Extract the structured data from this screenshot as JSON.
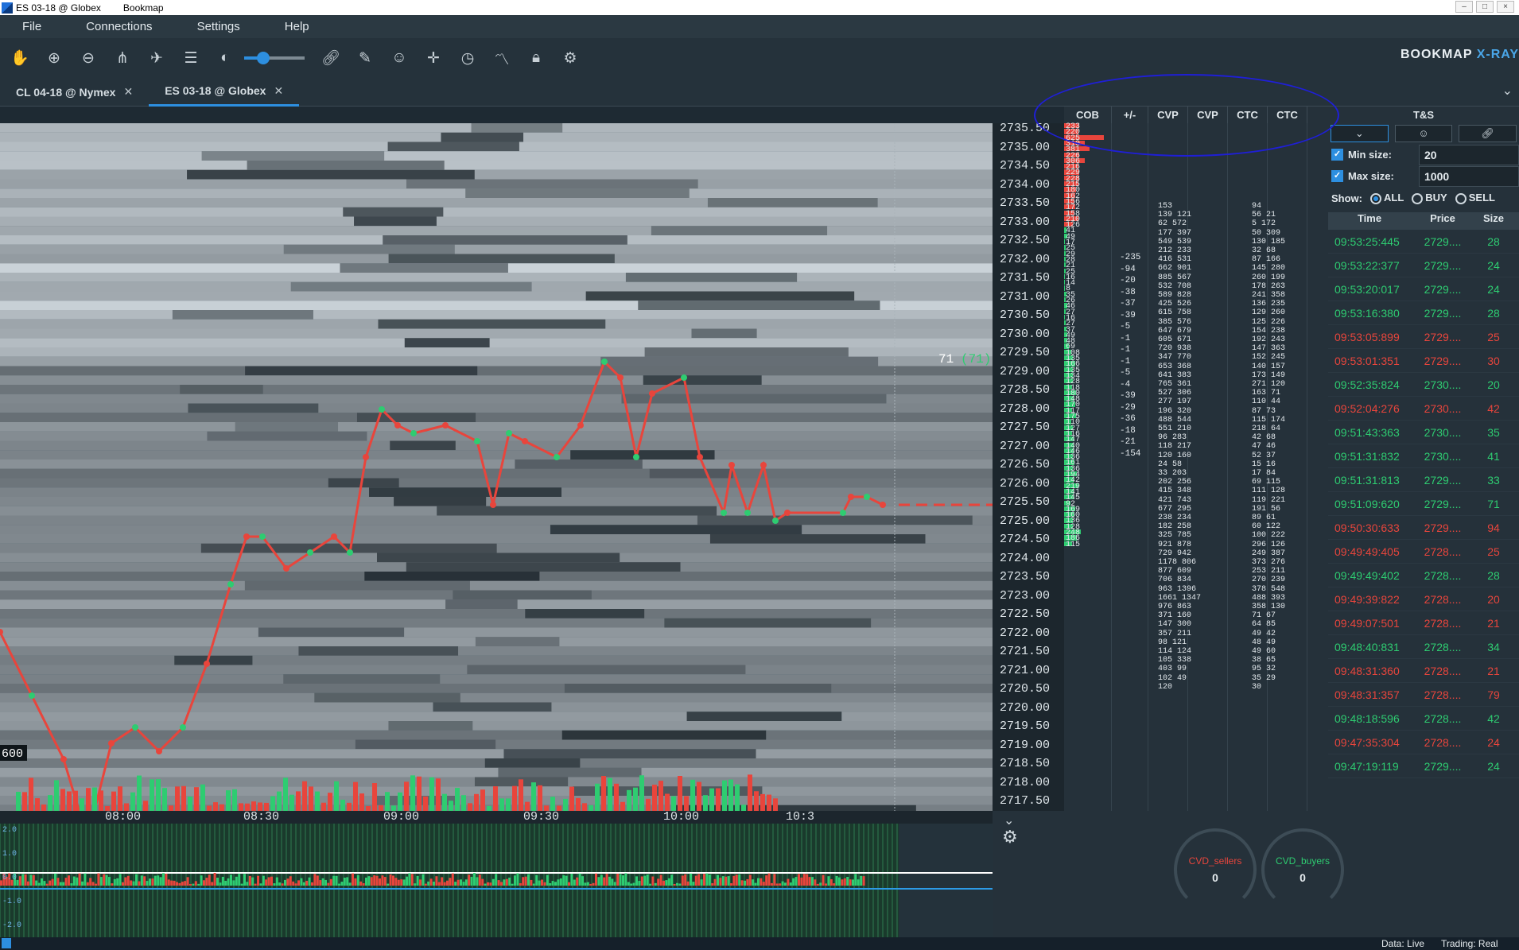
{
  "window": {
    "title": "ES 03-18 @ Globex",
    "app": "Bookmap"
  },
  "menu": [
    "File",
    "Connections",
    "Settings",
    "Help"
  ],
  "toolbar": {
    "icons": [
      "hand-icon",
      "zoom-in-icon",
      "zoom-out-icon",
      "share-icon",
      "plane-icon",
      "layers-icon",
      "brightness-icon",
      "link-icon",
      "pencil-icon",
      "chat-icon",
      "crosshair-icon",
      "timer-icon",
      "chart-line-icon",
      "lock-icon",
      "gear-icon"
    ],
    "brightness_level": 0.32,
    "brand": "BOOKMAP",
    "brand_suffix": "X-RAY"
  },
  "tabs": [
    {
      "label": "CL 04-18 @ Nymex",
      "active": false
    },
    {
      "label": "ES 03-18 @ Globex",
      "active": true
    }
  ],
  "price_axis": [
    "2735.50",
    "2735.00",
    "2734.50",
    "2734.00",
    "2733.50",
    "2733.00",
    "2732.50",
    "2732.00",
    "2731.50",
    "2731.00",
    "2730.50",
    "2730.00",
    "2729.50",
    "2729.00",
    "2728.50",
    "2728.00",
    "2727.50",
    "2727.00",
    "2726.50",
    "2726.00",
    "2725.50",
    "2725.00",
    "2724.50",
    "2724.00",
    "2723.50",
    "2723.00",
    "2722.50",
    "2722.00",
    "2721.50",
    "2721.00",
    "2720.50",
    "2720.00",
    "2719.50",
    "2719.00",
    "2718.50",
    "2718.00",
    "2717.50"
  ],
  "last_trade_label": {
    "size": "71",
    "paren": "(71)"
  },
  "volume_label": "600",
  "time_axis": [
    "08:00",
    "08:30",
    "09:00",
    "09:30",
    "10:00",
    "10:3"
  ],
  "ladder": {
    "headers": [
      "COB",
      "+/-",
      "CVP",
      "CVP",
      "CTC",
      "CTC"
    ],
    "cob": [
      "233",
      "220",
      "625",
      "310",
      "381",
      "226",
      "306",
      "216",
      "229",
      "228",
      "215",
      "180",
      "162",
      "156",
      "172",
      "158",
      "210",
      "126",
      "41",
      "49",
      "17",
      "25",
      "29",
      "28",
      "21",
      "25",
      "16",
      "14",
      "8",
      "35",
      "26",
      "46",
      "27",
      "16",
      "27",
      "37",
      "49",
      "48",
      "69",
      "108",
      "135",
      "166",
      "135",
      "134",
      "128",
      "118",
      "180",
      "148",
      "170",
      "117",
      "175",
      "110",
      "127",
      "116",
      "147",
      "140",
      "146",
      "136",
      "161",
      "136",
      "194",
      "142",
      "219",
      "141",
      "145",
      "92",
      "169",
      "160",
      "136",
      "128",
      "248",
      "186",
      "115"
    ],
    "plusminus": [
      "-235",
      "-94",
      "-20",
      "-38",
      "-37",
      "-39",
      "-5",
      "-1",
      "-1",
      "-1",
      "-5",
      "-4",
      "-39",
      "-29",
      "-36",
      "-18",
      "-21",
      "-154"
    ],
    "cvp": [
      "153",
      "139 121",
      "62 572",
      "177 397",
      "549 539",
      "212 233",
      "416 531",
      "662 901",
      "885 567",
      "532 708",
      "589 828",
      "425 526",
      "615 758",
      "385 576",
      "647 679",
      "605 671",
      "720 938",
      "347 770",
      "653 368",
      "641 383",
      "765 361",
      "527 306",
      "277 197",
      "196 320",
      "488 544",
      "551 210",
      "96 283",
      "118 217",
      "120 160",
      "24 58",
      "33 203",
      "202 256",
      "415 348",
      "421 743",
      "677 295",
      "238 234",
      "182 258",
      "325 785",
      "921 878",
      "729 942",
      "1178 806",
      "877 609",
      "706 834",
      "963 1396",
      "1661 1347",
      "976 863",
      "371 160",
      "147 300",
      "357 211",
      "98 121",
      "114 124",
      "105 338",
      "403 99",
      "102 49",
      "120"
    ],
    "ctc": [
      "94",
      "56 21",
      "5 172",
      "50 309",
      "130 185",
      "32 68",
      "87 166",
      "145 280",
      "260 199",
      "178 263",
      "241 358",
      "136 235",
      "129 260",
      "125 226",
      "154 238",
      "192 243",
      "147 363",
      "152 245",
      "140 157",
      "173 149",
      "271 120",
      "163 71",
      "110 44",
      "87 73",
      "115 174",
      "218 64",
      "42 68",
      "47 46",
      "52 37",
      "15 16",
      "17 84",
      "69 115",
      "111 128",
      "119 221",
      "191 56",
      "89 61",
      "60 122",
      "100 222",
      "296 126",
      "249 387",
      "373 276",
      "253 211",
      "270 239",
      "378 548",
      "488 393",
      "358 130",
      "71 67",
      "64 85",
      "49 42",
      "48 49",
      "49 60",
      "38 65",
      "95 32",
      "35 29",
      "30"
    ]
  },
  "ts": {
    "title": "T&S",
    "min_size_label": "Min size:",
    "min_size": "20",
    "max_size_label": "Max size:",
    "max_size": "1000",
    "show_label": "Show:",
    "show_options": [
      "ALL",
      "BUY",
      "SELL"
    ],
    "selected": "ALL",
    "columns": [
      "Time",
      "Price",
      "Size"
    ],
    "rows": [
      {
        "time": "09:53:25:445",
        "price": "2729....",
        "size": "28",
        "side": "buy"
      },
      {
        "time": "09:53:22:377",
        "price": "2729....",
        "size": "24",
        "side": "buy"
      },
      {
        "time": "09:53:20:017",
        "price": "2729....",
        "size": "24",
        "side": "buy"
      },
      {
        "time": "09:53:16:380",
        "price": "2729....",
        "size": "28",
        "side": "buy"
      },
      {
        "time": "09:53:05:899",
        "price": "2729....",
        "size": "25",
        "side": "sell"
      },
      {
        "time": "09:53:01:351",
        "price": "2729....",
        "size": "30",
        "side": "sell"
      },
      {
        "time": "09:52:35:824",
        "price": "2730....",
        "size": "20",
        "side": "buy"
      },
      {
        "time": "09:52:04:276",
        "price": "2730....",
        "size": "42",
        "side": "sell"
      },
      {
        "time": "09:51:43:363",
        "price": "2730....",
        "size": "35",
        "side": "buy"
      },
      {
        "time": "09:51:31:832",
        "price": "2730....",
        "size": "41",
        "side": "buy"
      },
      {
        "time": "09:51:31:813",
        "price": "2729....",
        "size": "33",
        "side": "buy"
      },
      {
        "time": "09:51:09:620",
        "price": "2729....",
        "size": "71",
        "side": "buy"
      },
      {
        "time": "09:50:30:633",
        "price": "2729....",
        "size": "94",
        "side": "sell"
      },
      {
        "time": "09:49:49:405",
        "price": "2728....",
        "size": "25",
        "side": "sell"
      },
      {
        "time": "09:49:49:402",
        "price": "2728....",
        "size": "28",
        "side": "buy"
      },
      {
        "time": "09:49:39:822",
        "price": "2728....",
        "size": "20",
        "side": "sell"
      },
      {
        "time": "09:49:07:501",
        "price": "2728....",
        "size": "21",
        "side": "sell"
      },
      {
        "time": "09:48:40:831",
        "price": "2728....",
        "size": "34",
        "side": "buy"
      },
      {
        "time": "09:48:31:360",
        "price": "2728....",
        "size": "21",
        "side": "sell"
      },
      {
        "time": "09:48:31:357",
        "price": "2728....",
        "size": "79",
        "side": "sell"
      },
      {
        "time": "09:48:18:596",
        "price": "2728....",
        "size": "42",
        "side": "buy"
      },
      {
        "time": "09:47:35:304",
        "price": "2728....",
        "size": "24",
        "side": "sell"
      },
      {
        "time": "09:47:19:119",
        "price": "2729....",
        "size": "24",
        "side": "buy"
      }
    ]
  },
  "indicator_scale": [
    "2.0",
    "1.0",
    "0.0",
    "-1.0",
    "-2.0"
  ],
  "gauges": [
    {
      "label": "CVD_sellers",
      "value": "0"
    },
    {
      "label": "CVD_buyers",
      "value": "0"
    }
  ],
  "status": {
    "data": "Data: Live",
    "trading": "Trading: Real"
  },
  "colors": {
    "buy": "#2ecc71",
    "sell": "#e8453c",
    "accent": "#2d8fe0",
    "annotation": "#1f1fd6"
  }
}
